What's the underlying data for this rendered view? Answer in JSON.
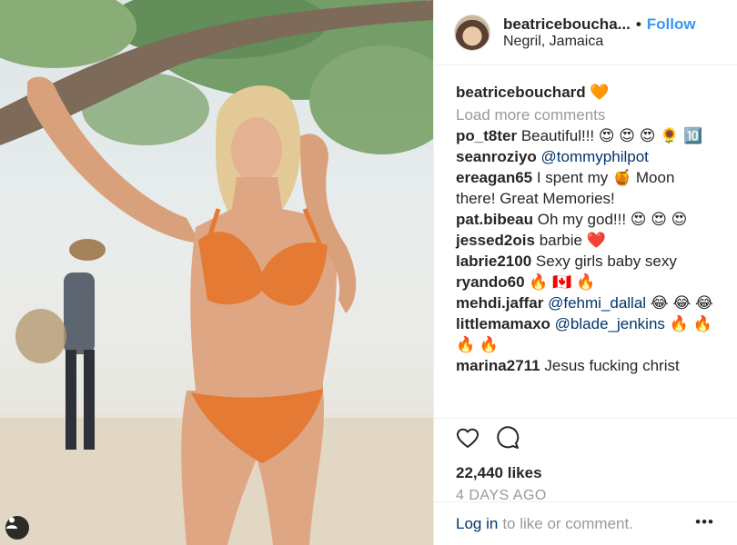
{
  "post": {
    "username": "beatricebouchard",
    "username_short": "beatriceboucha...",
    "follow_label": "Follow",
    "location": "Negril, Jamaica"
  },
  "caption": {
    "author": "beatricebouchard",
    "emoji": "🧡"
  },
  "load_more_label": "Load more comments",
  "comments": [
    {
      "author": "po_t8ter",
      "segments": [
        {
          "t": "Beautiful!!! 😍 😍 😍 🌻 🔟",
          "m": false
        }
      ]
    },
    {
      "author": "seanroziyo",
      "segments": [
        {
          "t": "@tommyphilpot",
          "m": true
        }
      ]
    },
    {
      "author": "ereagan65",
      "segments": [
        {
          "t": "I spent my 🍯 Moon there! Great Memories!",
          "m": false
        }
      ]
    },
    {
      "author": "pat.bibeau",
      "segments": [
        {
          "t": "Oh my god!!! 😍 😍 😍",
          "m": false
        }
      ]
    },
    {
      "author": "jessed2ois",
      "segments": [
        {
          "t": "barbie ❤️",
          "m": false
        }
      ]
    },
    {
      "author": "labrie2100",
      "segments": [
        {
          "t": "Sexy girls baby sexy",
          "m": false
        }
      ]
    },
    {
      "author": "ryando60",
      "segments": [
        {
          "t": "🔥 🇨🇦 🔥",
          "m": false
        }
      ]
    },
    {
      "author": "mehdi.jaffar",
      "segments": [
        {
          "t": "@fehmi_dallal",
          "m": true
        },
        {
          "t": " 😂 😂 😂",
          "m": false
        }
      ]
    },
    {
      "author": "littlemamaxo",
      "segments": [
        {
          "t": "@blade_jenkins",
          "m": true
        },
        {
          "t": " 🔥 🔥 🔥 🔥",
          "m": false
        }
      ]
    },
    {
      "author": "marina2711",
      "segments": [
        {
          "t": "Jesus fucking christ",
          "m": false
        }
      ]
    }
  ],
  "likes": "22,440 likes",
  "date": "4 DAYS AGO",
  "login": {
    "link": "Log in",
    "rest": "to like or comment."
  },
  "more_label": "•••",
  "icons": [
    "heart-icon",
    "comment-icon",
    "tag-user-icon",
    "more-options-icon"
  ]
}
